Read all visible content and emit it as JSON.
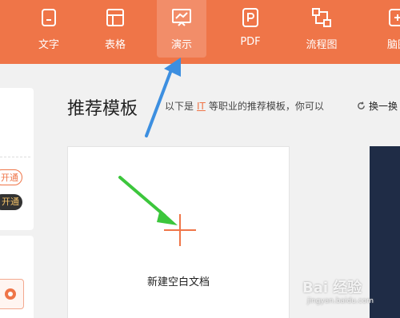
{
  "tabs": [
    {
      "label": "文字",
      "icon": "document-icon"
    },
    {
      "label": "表格",
      "icon": "table-icon"
    },
    {
      "label": "演示",
      "icon": "presentation-icon"
    },
    {
      "label": "PDF",
      "icon": "pdf-icon"
    },
    {
      "label": "流程图",
      "icon": "flowchart-icon"
    },
    {
      "label": "脑图",
      "icon": "mindmap-icon"
    }
  ],
  "left_panel": {
    "pill_open_1": "开通",
    "pill_open_2": "开通"
  },
  "main": {
    "title": "推荐模板",
    "subtitle_prefix": "以下是",
    "subtitle_link": "IT",
    "subtitle_suffix": "等职业的推荐模板，你可以",
    "refresh_label": "换一换",
    "new_blank_label": "新建空白文档"
  },
  "watermark": {
    "text": "Bai 经验",
    "url": "jingyan.baidu.com"
  },
  "colors": {
    "brand": "#ef7548",
    "annotation_blue": "#3d8fe0",
    "annotation_green": "#3cc63c"
  }
}
